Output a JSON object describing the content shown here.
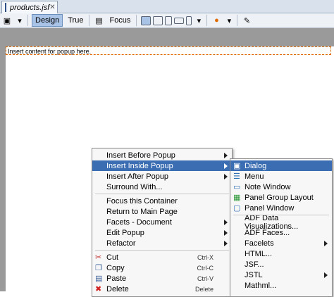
{
  "tab": {
    "title": "products.jsf"
  },
  "toolbar": {
    "design": "Design",
    "true": "True",
    "focus": "Focus"
  },
  "canvas": {
    "popup_hint": "Insert content for popup here."
  },
  "menu": [
    {
      "label": "Insert Before Popup",
      "submenu": true
    },
    {
      "label": "Insert Inside Popup",
      "submenu": true,
      "highlighted": true
    },
    {
      "label": "Insert After Popup",
      "submenu": true
    },
    {
      "label": "Surround With..."
    },
    {
      "label": "Focus this Container"
    },
    {
      "label": "Return to Main Page"
    },
    {
      "label": "Facets - Document",
      "submenu": true
    },
    {
      "label": "Edit Popup",
      "submenu": true
    },
    {
      "label": "Refactor",
      "submenu": true
    },
    {
      "label": "Cut",
      "shortcut": "Ctrl-X",
      "icon": "scissors-icon"
    },
    {
      "label": "Copy",
      "shortcut": "Ctrl-C",
      "icon": "copy-icon"
    },
    {
      "label": "Paste",
      "shortcut": "Ctrl-V",
      "icon": "paste-icon"
    },
    {
      "label": "Delete",
      "shortcut": "Delete",
      "icon": "delete-icon"
    }
  ],
  "submenu": [
    {
      "label": "Dialog",
      "icon": "dialog-icon",
      "highlighted": true
    },
    {
      "label": "Menu",
      "icon": "menu-icon"
    },
    {
      "label": "Note Window",
      "icon": "note-window-icon"
    },
    {
      "label": "Panel Group Layout",
      "icon": "panel-group-icon"
    },
    {
      "label": "Panel Window",
      "icon": "panel-window-icon"
    },
    {
      "label": "ADF Data Visualizations..."
    },
    {
      "label": "ADF Faces..."
    },
    {
      "label": "Facelets",
      "submenu": true
    },
    {
      "label": "HTML..."
    },
    {
      "label": "JSF..."
    },
    {
      "label": "JSTL",
      "submenu": true
    },
    {
      "label": "Mathml..."
    }
  ]
}
